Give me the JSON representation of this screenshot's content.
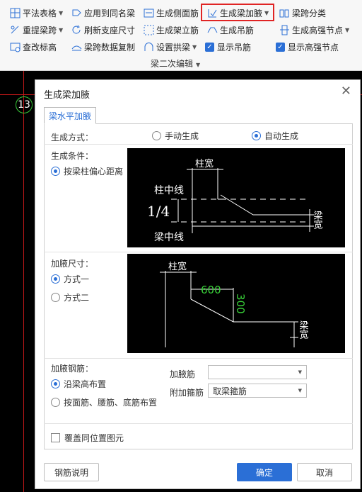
{
  "toolbar": {
    "row1": [
      {
        "label": "平法表格",
        "icon": "table-icon",
        "caret": true
      },
      {
        "label": "应用到同名梁",
        "icon": "apply-same-name-icon"
      },
      {
        "label": "生成侧面筋",
        "icon": "side-rebar-icon"
      },
      {
        "label": "生成梁加腋",
        "icon": "haunch-icon",
        "caret": true
      },
      {
        "label": "梁跨分类",
        "icon": "span-classify-icon"
      }
    ],
    "row2": [
      {
        "label": "重提梁跨",
        "icon": "reextract-span-icon",
        "caret": true
      },
      {
        "label": "刷新支座尺寸",
        "icon": "refresh-icon"
      },
      {
        "label": "生成架立筋",
        "icon": "erection-rebar-icon"
      },
      {
        "label": "生成吊筋",
        "icon": "hanger-rebar-icon"
      },
      {
        "label": "生成高强节点",
        "icon": "high-strength-node-icon",
        "caret": true
      }
    ],
    "row3": [
      {
        "label": "查改标高",
        "icon": "elevation-icon"
      },
      {
        "label": "梁跨数据复制",
        "icon": "span-copy-icon"
      },
      {
        "label": "设置拱梁",
        "icon": "arch-beam-icon",
        "caret": true
      },
      {
        "label": "显示吊筋",
        "checked": true
      },
      {
        "label": "显示高强节点",
        "checked": true
      }
    ],
    "group_label": "梁二次编辑",
    "highlight_color": "#e02424"
  },
  "cad": {
    "axis_number": "13"
  },
  "dialog": {
    "title": "生成梁加腋",
    "tab": "梁水平加腋",
    "mode_label": "生成方式：",
    "mode_options": [
      "手动生成",
      "自动生成"
    ],
    "mode_selected": 1,
    "condition_label": "生成条件：",
    "condition_option": "按梁柱偏心距离",
    "diagram1": {
      "col_width": "柱宽",
      "col_center": "柱中线",
      "ratio": "1/4",
      "beam_center": "梁中线",
      "beam_width": "梁宽"
    },
    "size_label": "加腋尺寸：",
    "size_options": [
      "方式一",
      "方式二"
    ],
    "size_selected": 0,
    "diagram2": {
      "col_width": "柱宽",
      "len": "600",
      "depth": "300",
      "beam_width": "梁宽"
    },
    "rebar_label": "加腋钢筋：",
    "rebar_options": [
      "沿梁高布置",
      "按面筋、腰筋、底筋布置"
    ],
    "rebar_selected": 0,
    "haunch_rebar_label": "加腋筋",
    "haunch_rebar_value": "",
    "stirrup_label": "附加箍筋",
    "stirrup_value": "取梁箍筋",
    "overlay_label": "覆盖同位置图元",
    "overlay_checked": false,
    "help_button": "钢筋说明",
    "ok_button": "确定",
    "cancel_button": "取消",
    "accent_color": "#2b6fd6"
  }
}
